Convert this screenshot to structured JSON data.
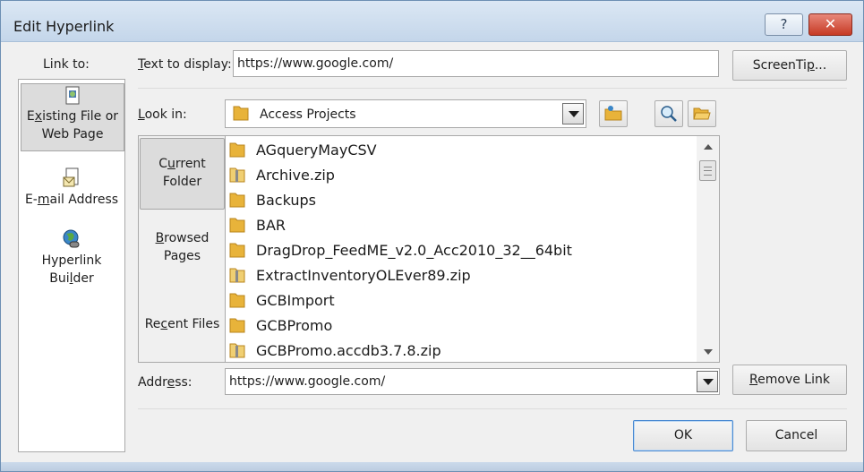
{
  "window": {
    "title": "Edit Hyperlink",
    "help_label": "?",
    "close_label": "✕"
  },
  "link_to": {
    "label": "Link to:",
    "items": [
      {
        "label_pre": "E",
        "label_ul": "x",
        "label_post": "isting File or",
        "label_line2": "Web Page",
        "icon": "existing-file-icon",
        "selected": true
      },
      {
        "label_pre": "E-",
        "label_ul": "m",
        "label_post": "ail Address",
        "icon": "email-address-icon",
        "selected": false
      },
      {
        "label_pre": "Hyperlink",
        "label_line2_pre": "Bui",
        "label_line2_ul": "l",
        "label_line2_post": "der",
        "icon": "hyperlink-builder-icon",
        "selected": false
      }
    ]
  },
  "text_to_display": {
    "label_ul": "T",
    "label_rest": "ext to display:",
    "value": "https://www.google.com/"
  },
  "screentip_button": {
    "label_pre": "ScreenTi",
    "label_ul": "p",
    "label_post": "..."
  },
  "look_in": {
    "label_ul": "L",
    "label_rest": "ook in:",
    "value": "Access Projects"
  },
  "places": [
    {
      "line1_pre": "C",
      "line1_ul": "u",
      "line1_post": "rrent",
      "line2": "Folder",
      "selected": true
    },
    {
      "line1_ul": "B",
      "line1_rest": "rowsed",
      "line2": "Pages",
      "selected": false
    },
    {
      "line1_pre": "Re",
      "line1_ul": "c",
      "line1_post": "ent Files",
      "selected": false
    }
  ],
  "files": [
    {
      "name": "AGqueryMayCSV",
      "type": "folder"
    },
    {
      "name": "Archive.zip",
      "type": "zip"
    },
    {
      "name": "Backups",
      "type": "folder"
    },
    {
      "name": "BAR",
      "type": "folder"
    },
    {
      "name": "DragDrop_FeedME_v2.0_Acc2010_32__64bit",
      "type": "folder"
    },
    {
      "name": "ExtractInventoryOLEver89.zip",
      "type": "zip"
    },
    {
      "name": "GCBImport",
      "type": "folder"
    },
    {
      "name": "GCBPromo",
      "type": "folder"
    },
    {
      "name": "GCBPromo.accdb3.7.8.zip",
      "type": "zip"
    }
  ],
  "address": {
    "label_pre": "Addr",
    "label_ul": "e",
    "label_post": "ss:",
    "value": "https://www.google.com/"
  },
  "remove_link_button": {
    "label_ul": "R",
    "label_rest": "emove Link"
  },
  "ok_button": {
    "label": "OK"
  },
  "cancel_button": {
    "label": "Cancel"
  },
  "colors": {
    "folder": "#e8b33a",
    "selection": "#dcdcdc",
    "title_bar": "#c4d6ea",
    "close": "#c63a24"
  }
}
